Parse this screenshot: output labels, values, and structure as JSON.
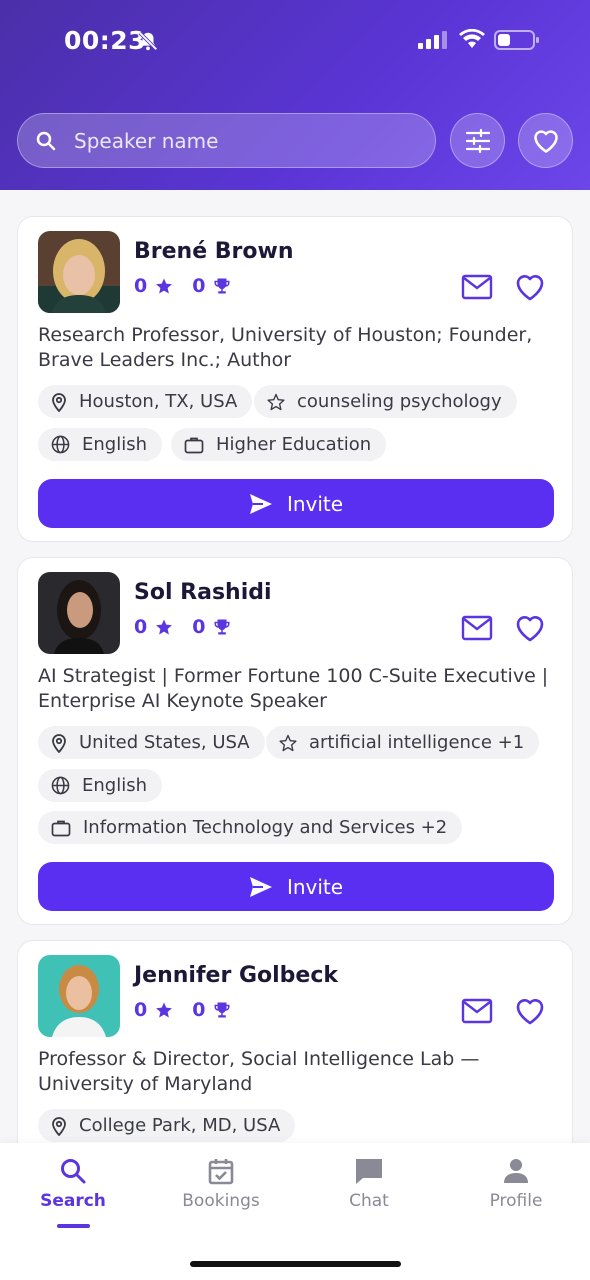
{
  "status_bar": {
    "time": "00:23"
  },
  "search": {
    "placeholder": "Speaker name"
  },
  "speakers": [
    {
      "name": "Brené Brown",
      "rating": "0",
      "awards": "0",
      "description": "Research Professor, University of Houston; Founder, Brave Leaders Inc.; Author",
      "location": "Houston, TX, USA",
      "topic": "counseling psychology",
      "language": "English",
      "industry": "Higher Education",
      "invite_label": "Invite"
    },
    {
      "name": "Sol Rashidi",
      "rating": "0",
      "awards": "0",
      "description": "AI Strategist | Former Fortune 100 C-Suite Executive | Enterprise AI Keynote Speaker",
      "location": "United States, USA",
      "topic": "artificial intelligence +1",
      "language": "English",
      "industry": "Information Technology and Services +2",
      "invite_label": "Invite"
    },
    {
      "name": "Jennifer Golbeck",
      "rating": "0",
      "awards": "0",
      "description": "Professor & Director, Social Intelligence Lab — University of Maryland",
      "location": "College Park, MD, USA"
    }
  ],
  "tabs": [
    {
      "label": "Search",
      "icon": "search-icon",
      "active": true
    },
    {
      "label": "Bookings",
      "icon": "calendar-check-icon",
      "active": false
    },
    {
      "label": "Chat",
      "icon": "chat-icon",
      "active": false
    },
    {
      "label": "Profile",
      "icon": "person-icon",
      "active": false
    }
  ],
  "colors": {
    "accent": "#5b2ff2",
    "header_start": "#4a2fa8",
    "header_end": "#6d46ea"
  }
}
